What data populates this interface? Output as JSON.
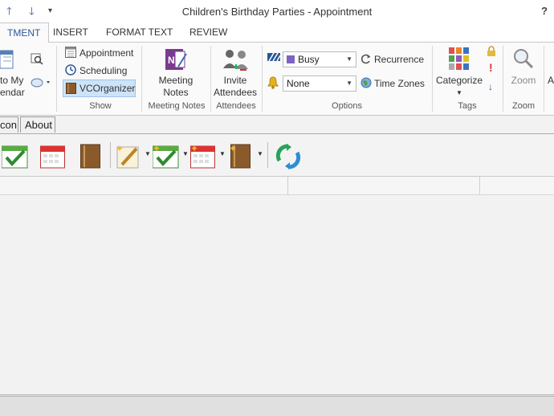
{
  "window": {
    "title": "Children's Birthday Parties - Appointment",
    "help_label": "?"
  },
  "tabs": [
    {
      "label": "TMENT",
      "active": true
    },
    {
      "label": "INSERT"
    },
    {
      "label": "FORMAT TEXT"
    },
    {
      "label": "REVIEW"
    }
  ],
  "ribbon": {
    "calendar": {
      "line1": "to My",
      "line2": "endar"
    },
    "show": {
      "group_label": "Show",
      "items": [
        "Appointment",
        "Scheduling",
        "VCOrganizer"
      ]
    },
    "meeting_notes": {
      "line1": "Meeting",
      "line2": "Notes",
      "group_label": "Meeting Notes"
    },
    "attendees": {
      "line1": "Invite",
      "line2": "Attendees",
      "group_label": "Attendees"
    },
    "options": {
      "group_label": "Options",
      "show_as": "Busy",
      "reminder": "None",
      "recurrence": "Recurrence",
      "time_zones": "Time Zones",
      "colors": {
        "busy": "#7b64c4"
      }
    },
    "tags": {
      "categorize": "Categorize",
      "group_label": "Tags"
    },
    "zoom": {
      "button": "Zoom",
      "group_label": "Zoom"
    }
  },
  "subtabs": [
    {
      "label": "con"
    },
    {
      "label": "About"
    }
  ],
  "toolbar_icons": [
    "task-check-icon",
    "calendar-icon",
    "notebook-icon",
    "new-note-icon",
    "new-task-icon",
    "new-calendar-icon",
    "new-notebook-icon",
    "sync-icon"
  ],
  "colors": {
    "accent": "#2b579a"
  }
}
